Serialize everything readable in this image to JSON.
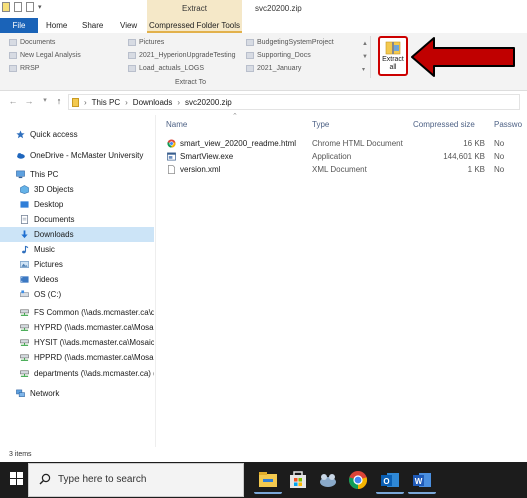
{
  "window": {
    "title": "svc20200.zip",
    "context_group": "Extract"
  },
  "tabs": {
    "file": "File",
    "home": "Home",
    "share": "Share",
    "view": "View",
    "compressed_folder_tools": "Compressed Folder Tools"
  },
  "ribbon": {
    "destinations": [
      {
        "label": "Documents"
      },
      {
        "label": "New Legal Analysis"
      },
      {
        "label": "RRSP"
      },
      {
        "label": "Pictures"
      },
      {
        "label": "2021_HyperionUpgradeTesting"
      },
      {
        "label": "Load_actuals_LOGS"
      },
      {
        "label": "BudgetingSystemProject"
      },
      {
        "label": "Supporting_Docs"
      },
      {
        "label": "2021_January"
      }
    ],
    "group_label": "Extract To",
    "extract_all_line1": "Extract",
    "extract_all_line2": "all"
  },
  "address": {
    "path": [
      "This PC",
      "Downloads",
      "svc20200.zip"
    ]
  },
  "nav": {
    "items": [
      {
        "label": "Quick access",
        "icon": "star-icon",
        "level": 0
      },
      {
        "label": "OneDrive - McMaster University",
        "icon": "cloud-icon",
        "level": 0
      },
      {
        "label": "This PC",
        "icon": "computer-icon",
        "level": 0
      },
      {
        "label": "3D Objects",
        "icon": "cube-icon",
        "level": 1
      },
      {
        "label": "Desktop",
        "icon": "desktop-icon",
        "level": 1
      },
      {
        "label": "Documents",
        "icon": "document-icon",
        "level": 1
      },
      {
        "label": "Downloads",
        "icon": "download-icon",
        "level": 1,
        "selected": true
      },
      {
        "label": "Music",
        "icon": "music-icon",
        "level": 1
      },
      {
        "label": "Pictures",
        "icon": "picture-icon",
        "level": 1
      },
      {
        "label": "Videos",
        "icon": "video-icon",
        "level": 1
      },
      {
        "label": "OS (C:)",
        "icon": "drive-icon",
        "level": 1
      },
      {
        "label": "FS Common (\\\\ads.mcmaster.ca\\de",
        "icon": "network-drive-icon",
        "level": 1
      },
      {
        "label": "HYPRD (\\\\ads.mcmaster.ca\\Mosaic",
        "icon": "network-drive-icon",
        "level": 1
      },
      {
        "label": "HYSIT (\\\\ads.mcmaster.ca\\Mosaic\\",
        "icon": "network-drive-icon",
        "level": 1
      },
      {
        "label": "HPPRD (\\\\ads.mcmaster.ca\\Mosaic",
        "icon": "network-drive-icon",
        "level": 1
      },
      {
        "label": "departments (\\\\ads.mcmaster.ca) (Z",
        "icon": "network-drive-icon",
        "level": 1
      },
      {
        "label": "Network",
        "icon": "network-icon",
        "level": 0
      }
    ]
  },
  "columns": {
    "name": "Name",
    "type": "Type",
    "compressed_size": "Compressed size",
    "password": "Passwo"
  },
  "files": [
    {
      "name": "smart_view_20200_readme.html",
      "type": "Chrome HTML Document",
      "size": "16 KB",
      "password": "No",
      "icon": "chrome-icon"
    },
    {
      "name": "SmartView.exe",
      "type": "Application",
      "size": "144,601 KB",
      "password": "No",
      "icon": "exe-icon"
    },
    {
      "name": "version.xml",
      "type": "XML Document",
      "size": "1 KB",
      "password": "No",
      "icon": "xml-file-icon"
    }
  ],
  "status": {
    "item_count": "3 items"
  },
  "taskbar": {
    "search_placeholder": "Type here to search"
  },
  "colors": {
    "file_tab": "#1a63b8",
    "context_tab": "#f5e8c8",
    "selection": "#cce4f7",
    "highlight": "#c00000",
    "taskbar": "#1c1c1c"
  }
}
